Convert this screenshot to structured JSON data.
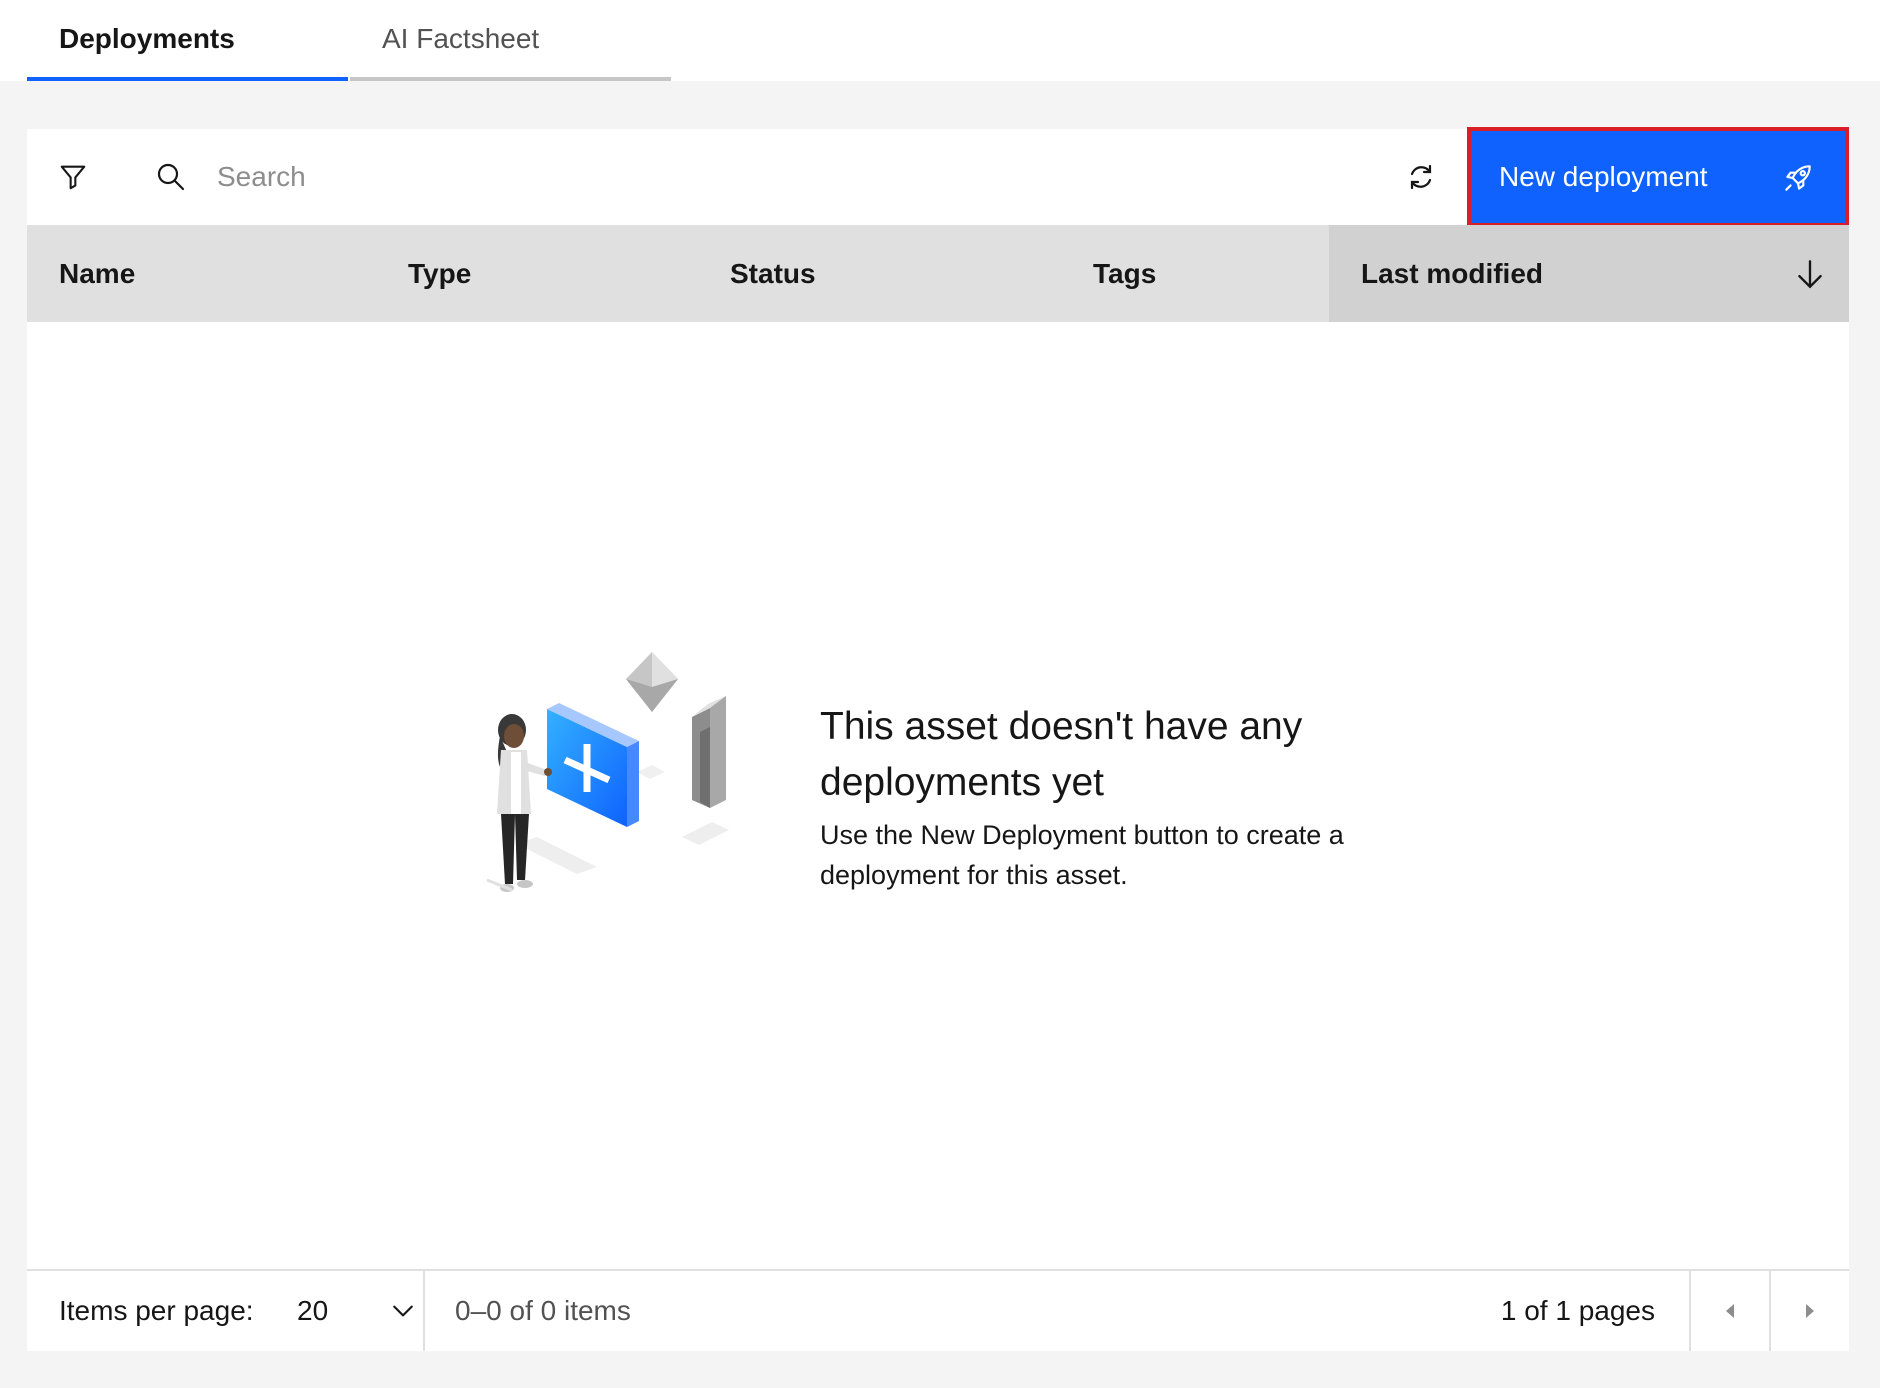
{
  "tabs": [
    {
      "label": "Deployments",
      "selected": true
    },
    {
      "label": "AI Factsheet",
      "selected": false
    }
  ],
  "toolbar": {
    "filter_icon": "filter-icon",
    "search_icon": "search-icon",
    "search_placeholder": "Search",
    "search_value": "",
    "refresh_icon": "refresh-icon",
    "new_button_label": "New deployment",
    "new_button_icon": "rocket-icon",
    "accent": "#0f62fe",
    "highlight_border": "#da1e28"
  },
  "table": {
    "columns": [
      "Name",
      "Type",
      "Status",
      "Tags",
      "Last modified"
    ],
    "sorted_column": "Last modified",
    "sort_icon": "arrow-down-icon",
    "rows": []
  },
  "empty_state": {
    "title": "This asset doesn't have any deployments yet",
    "body": "Use the New Deployment button to create a deployment for this asset.",
    "illustration": "person-with-plus-block-illustration"
  },
  "pagination": {
    "items_per_page_label": "Items per page:",
    "items_per_page_value": "20",
    "items_range": "0–0 of 0 items",
    "pages": "1 of 1 pages",
    "prev_icon": "caret-left-icon",
    "next_icon": "caret-right-icon"
  }
}
